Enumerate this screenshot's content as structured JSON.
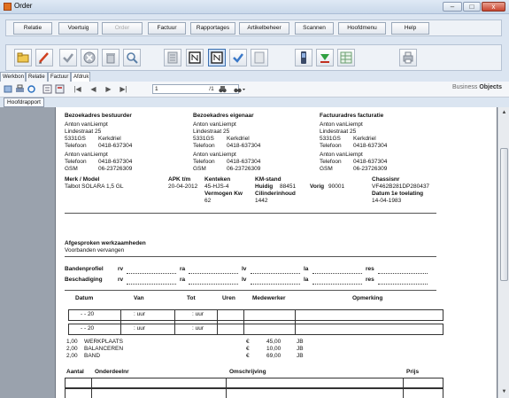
{
  "window": {
    "title": "Order",
    "min_label": "–",
    "max_label": "□",
    "close_label": "x"
  },
  "menu": {
    "items": [
      {
        "label": "Relatie",
        "enabled": true
      },
      {
        "label": "Voertuig",
        "enabled": true
      },
      {
        "label": "Order",
        "enabled": false
      },
      {
        "label": "Factuur",
        "enabled": true
      },
      {
        "label": "Rapportages",
        "enabled": true
      },
      {
        "label": "Artikelbeheer",
        "enabled": true
      },
      {
        "label": "Scannen",
        "enabled": true
      },
      {
        "label": "Hoofdmenu",
        "enabled": true
      },
      {
        "label": "Help",
        "enabled": true
      }
    ]
  },
  "toolbar": {
    "icons": [
      "new-folder-icon",
      "edit-pencil-icon",
      "check-icon",
      "cancel-icon",
      "trash-icon",
      "search-icon",
      "list-icon",
      "form-icon",
      "form-selected-icon",
      "approve-icon",
      "document-icon",
      "phone-icon",
      "download-icon",
      "spreadsheet-icon",
      "print-icon"
    ]
  },
  "tabs": [
    "Werkbon",
    "Relatie",
    "Factuur",
    "Afdruk"
  ],
  "viewer": {
    "page_value": "1",
    "page_count": "/1",
    "brand_prefix": "Business",
    "brand_suffix": "Objects",
    "group_tree_label": "Hoofdrapport",
    "nav_first": "|◀",
    "nav_prev": "◀",
    "nav_next": "▶",
    "nav_last": "▶|"
  },
  "report": {
    "bestuurder": {
      "heading": "Bezoekadres bestuurder",
      "name": "Anton vanLiempt",
      "street": "Lindestraat 25",
      "postcode": "5331GS",
      "city": "Kerkdriel",
      "phone_label": "Telefoon",
      "phone": "0418-637304",
      "name2": "Anton vanLiempt",
      "phone2_label": "Telefoon",
      "phone2": "0418-637304",
      "gsm_label": "GSM",
      "gsm": "06-23726309"
    },
    "eigenaar": {
      "heading": "Bezoekadres eigenaar",
      "name": "Anton vanLiempt",
      "street": "Lindestraat 25",
      "postcode": "5331GS",
      "city": "Kerkdriel",
      "phone_label": "Telefoon",
      "phone": "0418-637304",
      "name2": "Anton vanLiempt",
      "phone2_label": "Telefoon",
      "phone2": "0418-637304",
      "gsm_label": "GSM",
      "gsm": "06-23726309"
    },
    "factuur": {
      "heading": "Factuuradres facturatie",
      "name": "Anton vanLiempt",
      "street": "Lindestraat 25",
      "postcode": "5331GS",
      "city": "Kerkdriel",
      "phone_label": "Telefoon",
      "phone": "0418-637304",
      "name2": "Anton vanLiempt",
      "phone2_label": "Telefoon",
      "phone2": "0418-637304",
      "gsm_label": "GSM",
      "gsm": "06-23726309"
    },
    "vehicle": {
      "merk_label": "Merk / Model",
      "merk_value": "Talbot SOLARA 1,5 GL",
      "apk_label": "APK t/m",
      "apk_value": "20-04-2012",
      "kenteken_label": "Kenteken",
      "kenteken_value": "45-HJS-4",
      "vermogen_label": "Vermogen Kw",
      "vermogen_value": "62",
      "km_label": "KM-stand",
      "huidig_label": "Huidig",
      "huidig_value": "88451",
      "vorig_label": "Vorig",
      "vorig_value": "90001",
      "cilinder_label": "Cilinderinhoud",
      "cilinder_value": "1442",
      "chassis_label": "Chassisnr",
      "chassis_value": "VF462B281DP280437",
      "datum_label": "Datum 1e toelating",
      "datum_value": "14-04-1983"
    },
    "afgesproken": {
      "heading": "Afgesproken werkzaamheden",
      "text": "Voorbanden vervangen"
    },
    "tyres": {
      "rows": [
        {
          "label": "Bandenprofiel"
        },
        {
          "label": "Beschadiging"
        }
      ],
      "cols": [
        "rv",
        "ra",
        "lv",
        "la",
        "res"
      ]
    },
    "hours": {
      "headers": [
        "Datum",
        "Van",
        "Tot",
        "Uren",
        "Medewerker",
        "Opmerking"
      ],
      "rows": [
        {
          "datum": "-     - 20",
          "van": ":     uur",
          "tot": ":     uur"
        },
        {
          "datum": "-     - 20",
          "van": ":     uur",
          "tot": ":     uur"
        }
      ]
    },
    "lines": [
      {
        "qty": "1,00",
        "desc": "WERKPLAATS",
        "cur": "€",
        "price": "45,00",
        "code": "JB"
      },
      {
        "qty": "2,00",
        "desc": "BALANCEREN",
        "cur": "€",
        "price": "10,00",
        "code": "JB"
      },
      {
        "qty": "2,00",
        "desc": "BAND",
        "cur": "€",
        "price": "69,00",
        "code": "JB"
      }
    ],
    "parts": {
      "headers": [
        "Aantal",
        "Onderdeelnr",
        "Omschrijving",
        "Prijs"
      ]
    }
  },
  "colors": {
    "titlebar": "#c9d8ea",
    "background": "#dbe5f1",
    "report_bg": "#9aa2ad",
    "close": "#c8452f"
  }
}
